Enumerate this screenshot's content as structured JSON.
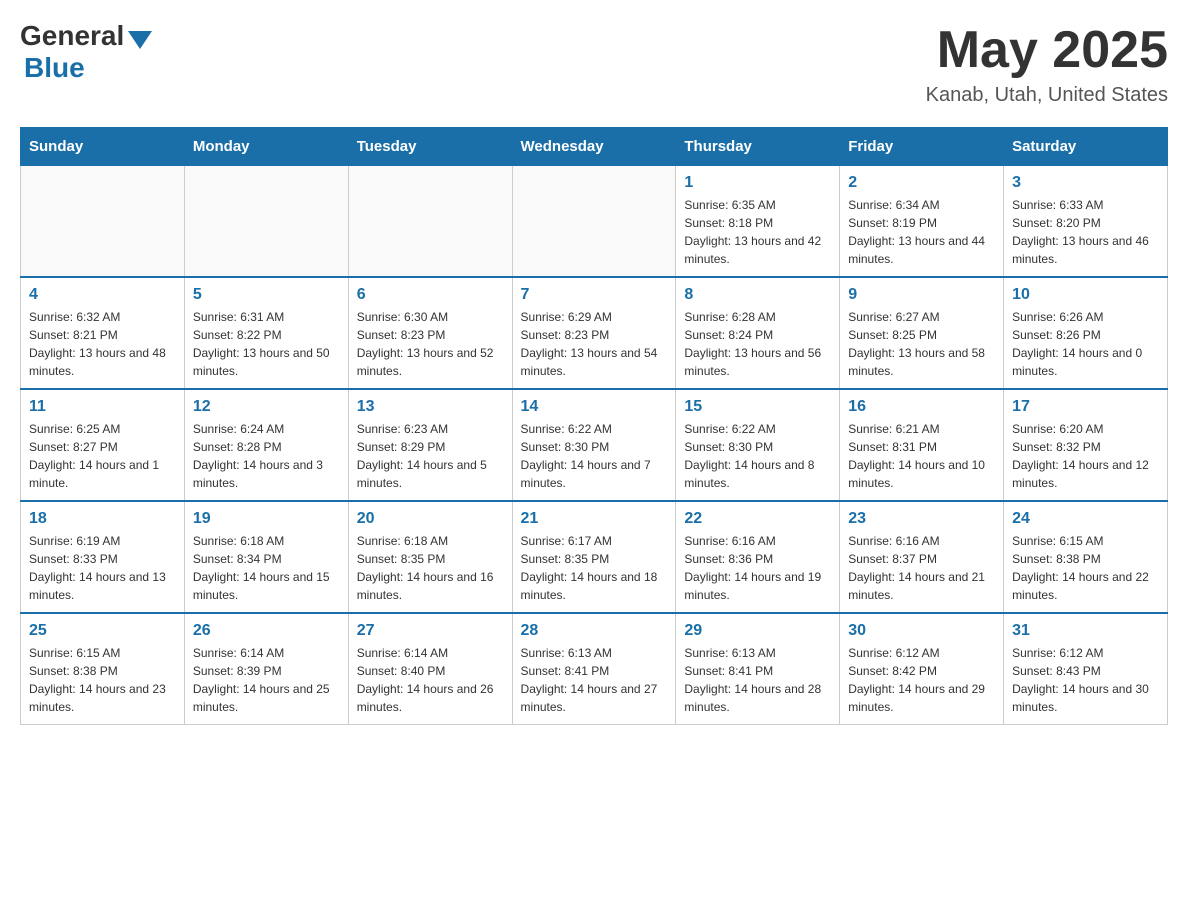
{
  "header": {
    "logo_general": "General",
    "logo_blue": "Blue",
    "month_title": "May 2025",
    "location": "Kanab, Utah, United States"
  },
  "weekdays": [
    "Sunday",
    "Monday",
    "Tuesday",
    "Wednesday",
    "Thursday",
    "Friday",
    "Saturday"
  ],
  "weeks": [
    [
      {
        "day": "",
        "info": ""
      },
      {
        "day": "",
        "info": ""
      },
      {
        "day": "",
        "info": ""
      },
      {
        "day": "",
        "info": ""
      },
      {
        "day": "1",
        "info": "Sunrise: 6:35 AM\nSunset: 8:18 PM\nDaylight: 13 hours and 42 minutes."
      },
      {
        "day": "2",
        "info": "Sunrise: 6:34 AM\nSunset: 8:19 PM\nDaylight: 13 hours and 44 minutes."
      },
      {
        "day": "3",
        "info": "Sunrise: 6:33 AM\nSunset: 8:20 PM\nDaylight: 13 hours and 46 minutes."
      }
    ],
    [
      {
        "day": "4",
        "info": "Sunrise: 6:32 AM\nSunset: 8:21 PM\nDaylight: 13 hours and 48 minutes."
      },
      {
        "day": "5",
        "info": "Sunrise: 6:31 AM\nSunset: 8:22 PM\nDaylight: 13 hours and 50 minutes."
      },
      {
        "day": "6",
        "info": "Sunrise: 6:30 AM\nSunset: 8:23 PM\nDaylight: 13 hours and 52 minutes."
      },
      {
        "day": "7",
        "info": "Sunrise: 6:29 AM\nSunset: 8:23 PM\nDaylight: 13 hours and 54 minutes."
      },
      {
        "day": "8",
        "info": "Sunrise: 6:28 AM\nSunset: 8:24 PM\nDaylight: 13 hours and 56 minutes."
      },
      {
        "day": "9",
        "info": "Sunrise: 6:27 AM\nSunset: 8:25 PM\nDaylight: 13 hours and 58 minutes."
      },
      {
        "day": "10",
        "info": "Sunrise: 6:26 AM\nSunset: 8:26 PM\nDaylight: 14 hours and 0 minutes."
      }
    ],
    [
      {
        "day": "11",
        "info": "Sunrise: 6:25 AM\nSunset: 8:27 PM\nDaylight: 14 hours and 1 minute."
      },
      {
        "day": "12",
        "info": "Sunrise: 6:24 AM\nSunset: 8:28 PM\nDaylight: 14 hours and 3 minutes."
      },
      {
        "day": "13",
        "info": "Sunrise: 6:23 AM\nSunset: 8:29 PM\nDaylight: 14 hours and 5 minutes."
      },
      {
        "day": "14",
        "info": "Sunrise: 6:22 AM\nSunset: 8:30 PM\nDaylight: 14 hours and 7 minutes."
      },
      {
        "day": "15",
        "info": "Sunrise: 6:22 AM\nSunset: 8:30 PM\nDaylight: 14 hours and 8 minutes."
      },
      {
        "day": "16",
        "info": "Sunrise: 6:21 AM\nSunset: 8:31 PM\nDaylight: 14 hours and 10 minutes."
      },
      {
        "day": "17",
        "info": "Sunrise: 6:20 AM\nSunset: 8:32 PM\nDaylight: 14 hours and 12 minutes."
      }
    ],
    [
      {
        "day": "18",
        "info": "Sunrise: 6:19 AM\nSunset: 8:33 PM\nDaylight: 14 hours and 13 minutes."
      },
      {
        "day": "19",
        "info": "Sunrise: 6:18 AM\nSunset: 8:34 PM\nDaylight: 14 hours and 15 minutes."
      },
      {
        "day": "20",
        "info": "Sunrise: 6:18 AM\nSunset: 8:35 PM\nDaylight: 14 hours and 16 minutes."
      },
      {
        "day": "21",
        "info": "Sunrise: 6:17 AM\nSunset: 8:35 PM\nDaylight: 14 hours and 18 minutes."
      },
      {
        "day": "22",
        "info": "Sunrise: 6:16 AM\nSunset: 8:36 PM\nDaylight: 14 hours and 19 minutes."
      },
      {
        "day": "23",
        "info": "Sunrise: 6:16 AM\nSunset: 8:37 PM\nDaylight: 14 hours and 21 minutes."
      },
      {
        "day": "24",
        "info": "Sunrise: 6:15 AM\nSunset: 8:38 PM\nDaylight: 14 hours and 22 minutes."
      }
    ],
    [
      {
        "day": "25",
        "info": "Sunrise: 6:15 AM\nSunset: 8:38 PM\nDaylight: 14 hours and 23 minutes."
      },
      {
        "day": "26",
        "info": "Sunrise: 6:14 AM\nSunset: 8:39 PM\nDaylight: 14 hours and 25 minutes."
      },
      {
        "day": "27",
        "info": "Sunrise: 6:14 AM\nSunset: 8:40 PM\nDaylight: 14 hours and 26 minutes."
      },
      {
        "day": "28",
        "info": "Sunrise: 6:13 AM\nSunset: 8:41 PM\nDaylight: 14 hours and 27 minutes."
      },
      {
        "day": "29",
        "info": "Sunrise: 6:13 AM\nSunset: 8:41 PM\nDaylight: 14 hours and 28 minutes."
      },
      {
        "day": "30",
        "info": "Sunrise: 6:12 AM\nSunset: 8:42 PM\nDaylight: 14 hours and 29 minutes."
      },
      {
        "day": "31",
        "info": "Sunrise: 6:12 AM\nSunset: 8:43 PM\nDaylight: 14 hours and 30 minutes."
      }
    ]
  ]
}
